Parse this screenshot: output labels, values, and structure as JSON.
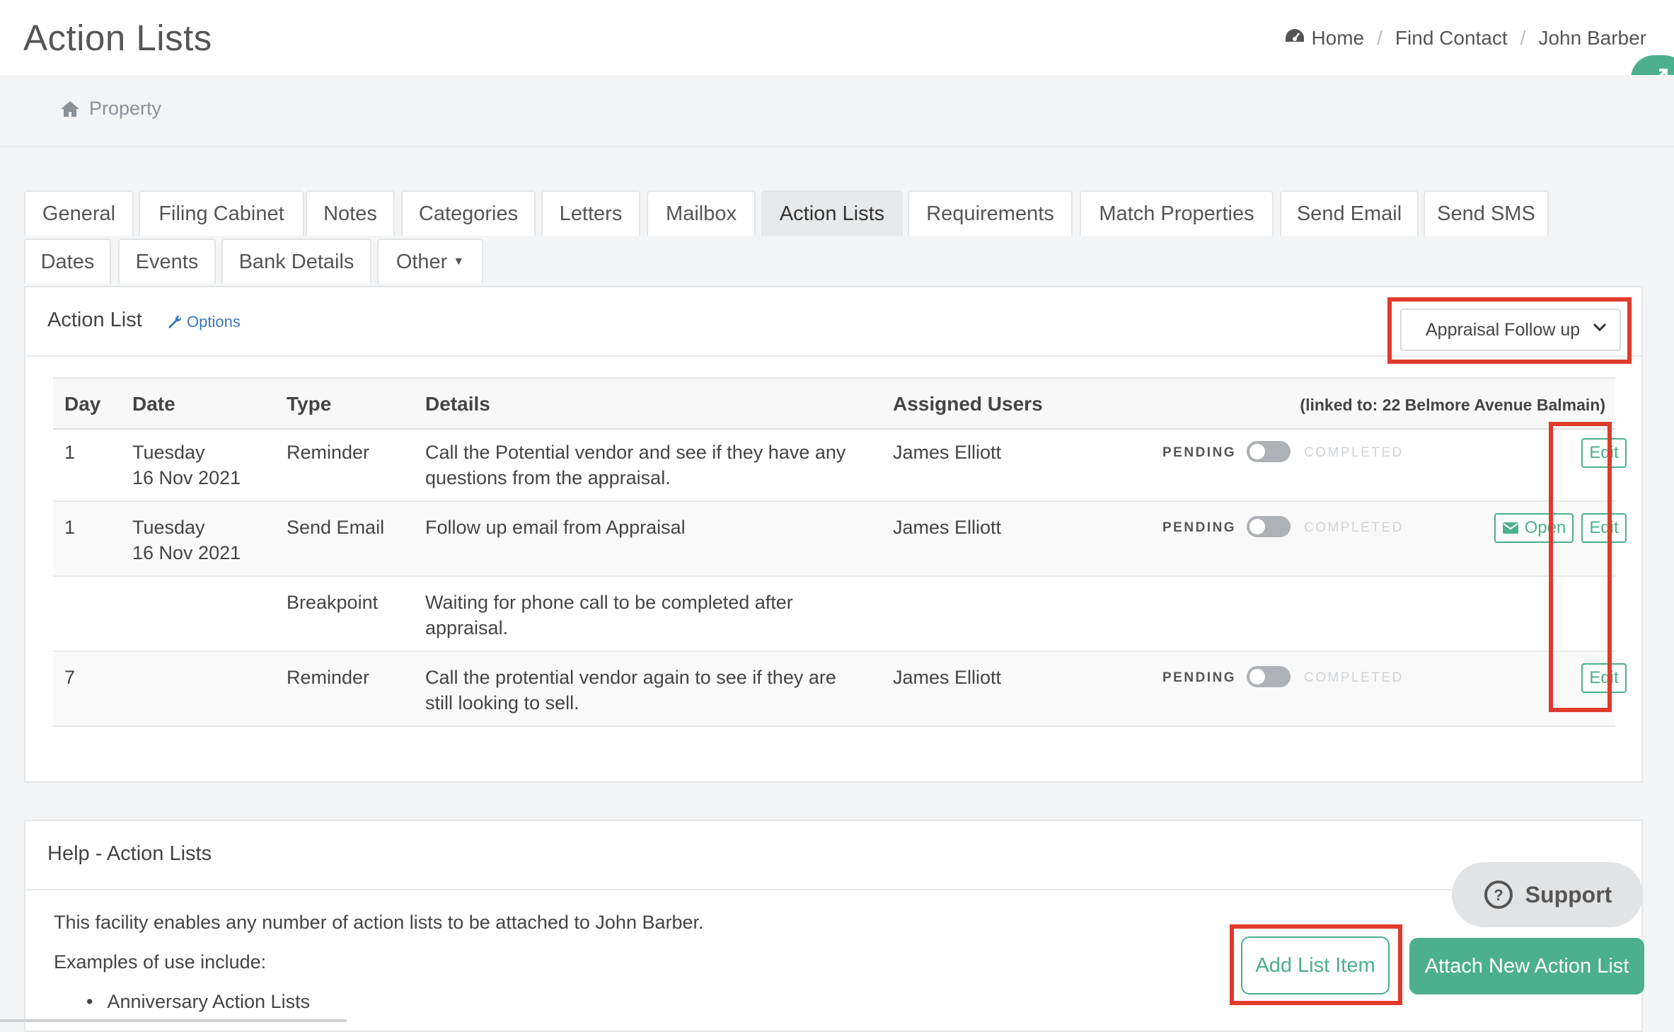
{
  "header": {
    "title": "Action Lists",
    "breadcrumb": [
      "Home",
      "Find Contact",
      "John Barber"
    ]
  },
  "subnav": {
    "property_label": "Property"
  },
  "tabs": {
    "row1": [
      "General",
      "Filing Cabinet",
      "Notes",
      "Categories",
      "Letters",
      "Mailbox",
      "Action Lists",
      "Requirements",
      "Match Properties",
      "Send Email",
      "Send SMS"
    ],
    "row2": [
      "Dates",
      "Events",
      "Bank Details",
      "Other"
    ],
    "active": "Action Lists"
  },
  "action_list": {
    "title": "Action List",
    "options_label": "Options",
    "selected_list": "Appraisal Follow up",
    "columns": [
      "Day",
      "Date",
      "Type",
      "Details",
      "Assigned Users"
    ],
    "linked_to": "(linked to: 22 Belmore Avenue Balmain)",
    "rows": [
      {
        "day": "1",
        "date_line1": "Tuesday",
        "date_line2": "16 Nov 2021",
        "type": "Reminder",
        "details_line1": "Call the Potential vendor and see if they have any",
        "details_line2": "questions from the appraisal.",
        "assigned": "James Elliott",
        "status_left": "PENDING",
        "status_right": "COMPLETED",
        "edit": "Edit"
      },
      {
        "day": "1",
        "date_line1": "Tuesday",
        "date_line2": "16 Nov 2021",
        "type": "Send Email",
        "details_line1": "Follow up email from Appraisal",
        "details_line2": "",
        "assigned": "James Elliott",
        "status_left": "PENDING",
        "status_right": "COMPLETED",
        "open": "Open",
        "edit": "Edit"
      },
      {
        "day": "",
        "date_line1": "",
        "date_line2": "",
        "type": "Breakpoint",
        "details_line1": "Waiting for phone call to be completed after",
        "details_line2": "appraisal.",
        "assigned": ""
      },
      {
        "day": "7",
        "date_line1": "",
        "date_line2": "",
        "type": "Reminder",
        "details_line1": "Call the protential vendor again to see if they are",
        "details_line2": "still looking to sell.",
        "assigned": "James Elliott",
        "status_left": "PENDING",
        "status_right": "COMPLETED",
        "edit": "Edit"
      }
    ]
  },
  "help": {
    "title": "Help - Action Lists",
    "text1": "This facility enables any number of action lists to be attached to John Barber.",
    "text2": "Examples of use include:",
    "bullet1": "Anniversary Action Lists"
  },
  "buttons": {
    "support": "Support",
    "add_list_item": "Add List Item",
    "attach_new": "Attach New Action List"
  },
  "colors": {
    "accent": "#4caf8e",
    "highlight": "#e03a2b"
  }
}
